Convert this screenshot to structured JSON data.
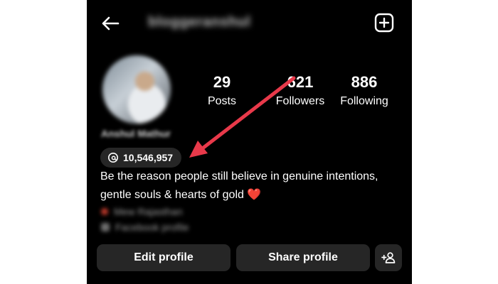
{
  "header": {
    "username": "bloggeranshul",
    "back_icon": "arrow-left-icon",
    "add_icon": "plus-square-icon"
  },
  "profile": {
    "display_name": "Anshul Mathur",
    "threads_count": "10,546,957",
    "bio_line1": "Be the reason people still believe in genuine intentions,",
    "bio_line2": "gentle souls & hearts of gold",
    "bio_emoji": "❤️",
    "link1": "Mew Rajasthan",
    "link2": "Facebook profile"
  },
  "stats": [
    {
      "count": "29",
      "label": "Posts"
    },
    {
      "count": "621",
      "label": "Followers"
    },
    {
      "count": "886",
      "label": "Following"
    }
  ],
  "actions": {
    "edit_label": "Edit profile",
    "share_label": "Share profile",
    "discover_icon": "add-person-icon"
  },
  "colors": {
    "background": "#000000",
    "button_bg": "#262626",
    "annotation_arrow": "#e8394a"
  }
}
